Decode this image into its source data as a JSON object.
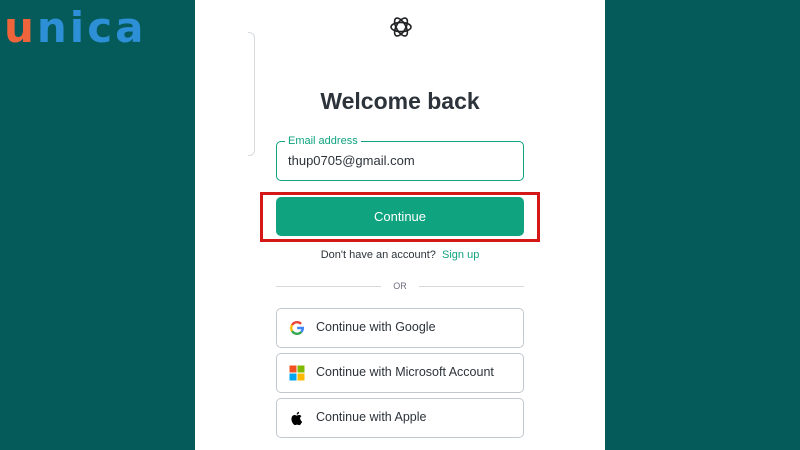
{
  "brand": {
    "first_letter": "u",
    "rest": "nica"
  },
  "login": {
    "title": "Welcome back",
    "email": {
      "label": "Email address",
      "value": "thup0705@gmail.com"
    },
    "continue_label": "Continue",
    "signup_prompt": "Don't have an account?",
    "signup_link": "Sign up",
    "divider_text": "OR",
    "social": [
      {
        "label": "Continue with Google",
        "icon": "google-icon"
      },
      {
        "label": "Continue with Microsoft Account",
        "icon": "microsoft-icon"
      },
      {
        "label": "Continue with Apple",
        "icon": "apple-icon"
      }
    ]
  },
  "colors": {
    "background": "#055a5a",
    "accent": "#10a37f",
    "highlight": "#d41818",
    "brand_orange": "#f0643c",
    "brand_blue": "#2d8fd5"
  }
}
